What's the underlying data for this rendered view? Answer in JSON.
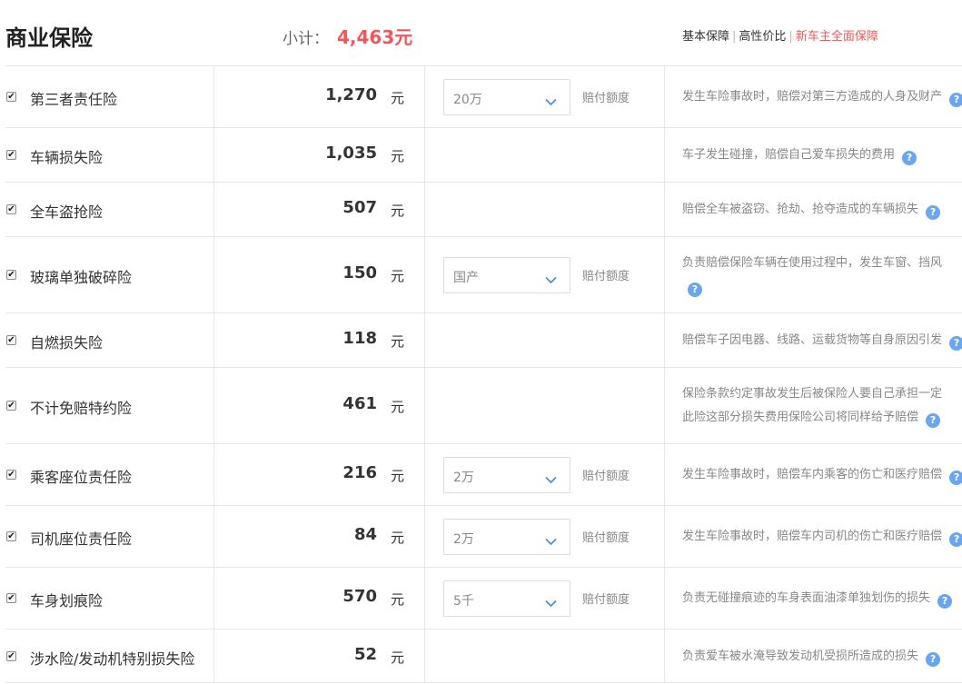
{
  "header": {
    "title": "商业保险",
    "subtotal_label": "小计：",
    "subtotal_value": "4,463元",
    "plans": [
      {
        "label": "基本保障",
        "active": false
      },
      {
        "label": "高性价比",
        "active": false
      },
      {
        "label": "新车主全面保障",
        "active": true
      }
    ]
  },
  "unit_label": "元",
  "coverage_label": "赔付额度",
  "help_icon": "?",
  "items": [
    {
      "name": "第三者责任险",
      "price": "1,270",
      "checked": true,
      "coverage": "20万",
      "desc": [
        "发生车险事故时，赔偿对第三方造成的人身及财产"
      ]
    },
    {
      "name": "车辆损失险",
      "price": "1,035",
      "checked": true,
      "coverage": null,
      "desc": [
        "车子发生碰撞，赔偿自己爱车损失的费用"
      ]
    },
    {
      "name": "全车盗抢险",
      "price": "507",
      "checked": true,
      "coverage": null,
      "desc": [
        "赔偿全车被盗窃、抢劫、抢夺造成的车辆损失"
      ]
    },
    {
      "name": "玻璃单独破碎险",
      "price": "150",
      "checked": true,
      "coverage": "国产",
      "desc": [
        "负责赔偿保险车辆在使用过程中，发生车窗、挡风",
        ""
      ]
    },
    {
      "name": "自燃损失险",
      "price": "118",
      "checked": true,
      "coverage": null,
      "desc": [
        "赔偿车子因电器、线路、运载货物等自身原因引发"
      ]
    },
    {
      "name": "不计免赔特约险",
      "price": "461",
      "checked": true,
      "coverage": null,
      "desc": [
        "保险条款约定事故发生后被保险人要自己承担一定",
        "此险这部分损失费用保险公司将同样给予赔偿"
      ]
    },
    {
      "name": "乘客座位责任险",
      "price": "216",
      "checked": true,
      "coverage": "2万",
      "desc": [
        "发生车险事故时，赔偿车内乘客的伤亡和医疗赔偿"
      ]
    },
    {
      "name": "司机座位责任险",
      "price": "84",
      "checked": true,
      "coverage": "2万",
      "desc": [
        "发生车险事故时，赔偿车内司机的伤亡和医疗赔偿"
      ]
    },
    {
      "name": "车身划痕险",
      "price": "570",
      "checked": true,
      "coverage": "5千",
      "desc": [
        "负责无碰撞痕迹的车身表面油漆单独划伤的损失"
      ]
    },
    {
      "name": "涉水险/发动机特别损失险",
      "price": "52",
      "checked": true,
      "coverage": null,
      "desc": [
        "负责爱车被水淹导致发动机受损所造成的损失"
      ]
    }
  ]
}
